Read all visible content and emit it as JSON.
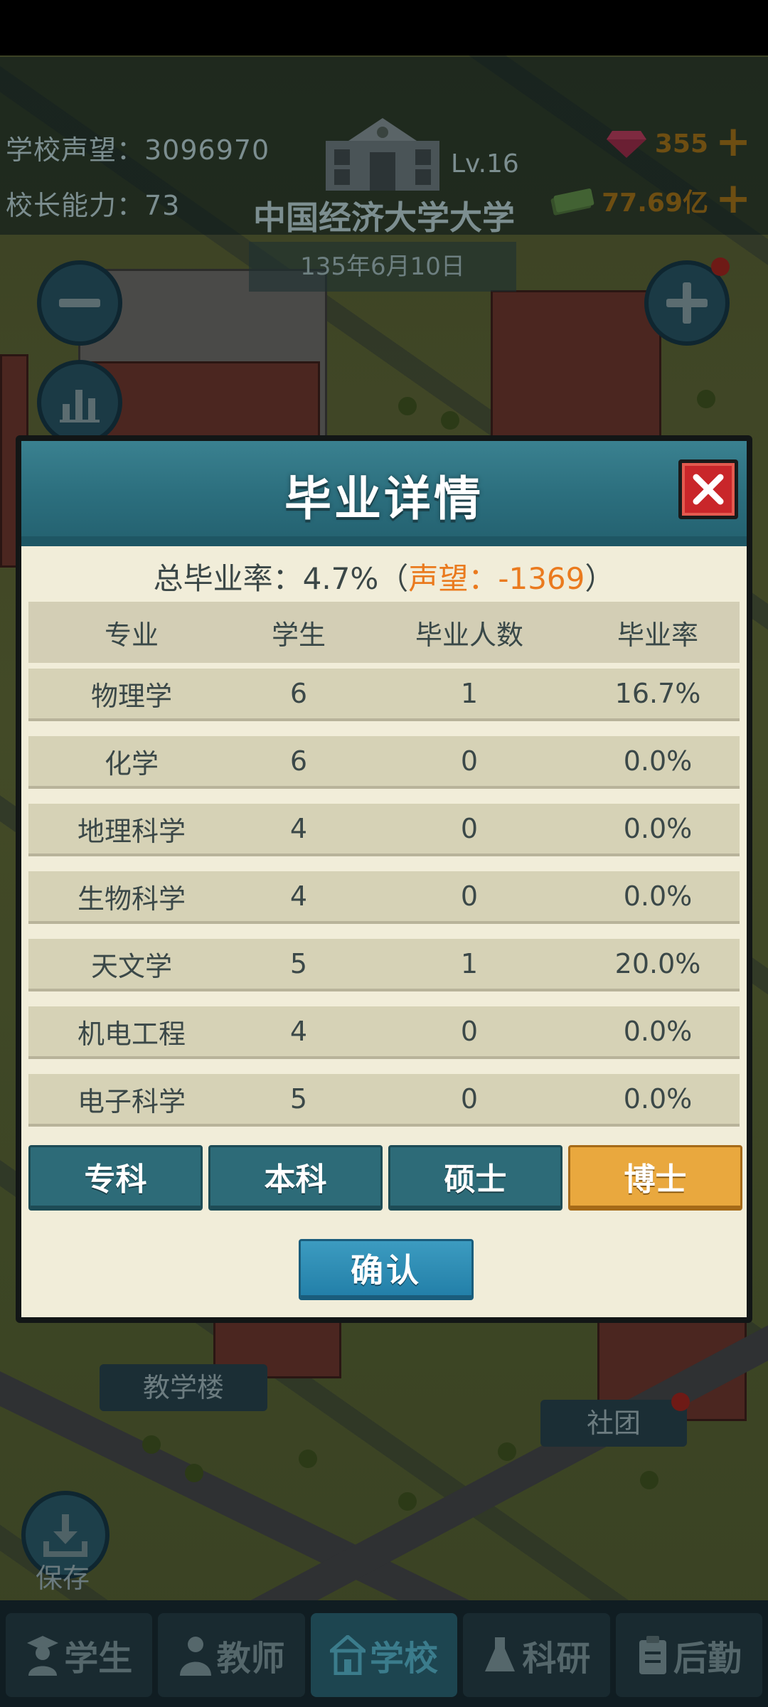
{
  "header": {
    "reputation_label": "学校声望：3096970",
    "ability_label": "校长能力：73",
    "level": "Lv.16",
    "school_name": "中国经济大学大学",
    "date": "135年6月10日",
    "gems": "355",
    "money": "77.69亿"
  },
  "map_labels": {
    "teaching_building": "教学楼",
    "club": "社团",
    "save": "保存"
  },
  "modal": {
    "title": "毕业详情",
    "summary_prefix": "总毕业率：4.7%（",
    "summary_reputation": "声望：-1369",
    "summary_suffix": "）",
    "columns": [
      "专业",
      "学生",
      "毕业人数",
      "毕业率"
    ],
    "rows": [
      {
        "major": "物理学",
        "students": "6",
        "graduates": "1",
        "rate": "16.7%"
      },
      {
        "major": "化学",
        "students": "6",
        "graduates": "0",
        "rate": "0.0%"
      },
      {
        "major": "地理科学",
        "students": "4",
        "graduates": "0",
        "rate": "0.0%"
      },
      {
        "major": "生物科学",
        "students": "4",
        "graduates": "0",
        "rate": "0.0%"
      },
      {
        "major": "天文学",
        "students": "5",
        "graduates": "1",
        "rate": "20.0%"
      },
      {
        "major": "机电工程",
        "students": "4",
        "graduates": "0",
        "rate": "0.0%"
      },
      {
        "major": "电子科学",
        "students": "5",
        "graduates": "0",
        "rate": "0.0%"
      }
    ],
    "tabs": [
      "专科",
      "本科",
      "硕士",
      "博士"
    ],
    "selected_tab": "博士",
    "confirm": "确认"
  },
  "bottom_nav": {
    "items": [
      "学生",
      "教师",
      "学校",
      "科研",
      "后勤"
    ],
    "active": "学校"
  },
  "colors": {
    "modal_bg": "#f1edd9",
    "header_teal": "#2c6f7e",
    "tab_selected": "#e9a83e",
    "close_red": "#c9262a",
    "reputation_orange": "#ea7a1e"
  }
}
